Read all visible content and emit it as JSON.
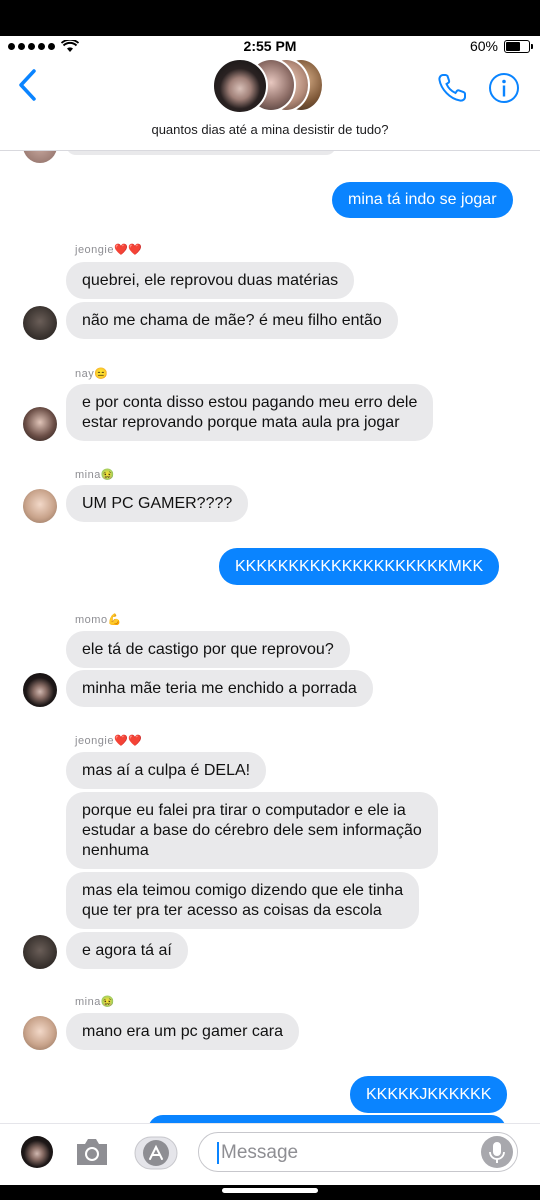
{
  "status_bar": {
    "time": "2:55 PM",
    "battery": "60%"
  },
  "header": {
    "title": "quantos dias até a mina desistir de tudo?"
  },
  "colors": {
    "accent": "#0a84ff",
    "received_bubble": "#e9e9eb",
    "sent_bubble": "#0a84ff"
  },
  "messages": [
    {
      "text": "mina tá indo se jogar"
    },
    {
      "sender": "jeongie❤️❤️"
    },
    {
      "text": "quebrei, ele reprovou duas matérias"
    },
    {
      "text": "não me chama de mãe? é meu filho então"
    },
    {
      "sender": "nay😑"
    },
    {
      "text": "e por conta disso estou pagando meu erro dele\nestar reprovando porque mata aula pra jogar"
    },
    {
      "sender": "mina🤢"
    },
    {
      "text": "UM PC GAMER????"
    },
    {
      "text": "KKKKKKKKKKKKKKKKKKKKMKK"
    },
    {
      "sender": "momo💪"
    },
    {
      "text": "ele tá de castigo por que reprovou?"
    },
    {
      "text": "minha mãe teria me enchido a porrada"
    },
    {
      "sender": "jeongie❤️❤️"
    },
    {
      "text": "mas aí a culpa é DELA!"
    },
    {
      "text": "porque eu falei pra tirar o computador e ele ia\nestudar a base do cérebro dele sem informação\nnenhuma"
    },
    {
      "text": "mas ela teimou comigo dizendo que ele tinha\nque ter pra ter acesso as coisas da escola"
    },
    {
      "text": "e agora tá aí"
    },
    {
      "sender": "mina🤢"
    },
    {
      "text": "mano era um pc gamer cara"
    },
    {
      "text": "KKKKKJKKKKKK"
    }
  ],
  "composer": {
    "placeholder": "Message"
  }
}
